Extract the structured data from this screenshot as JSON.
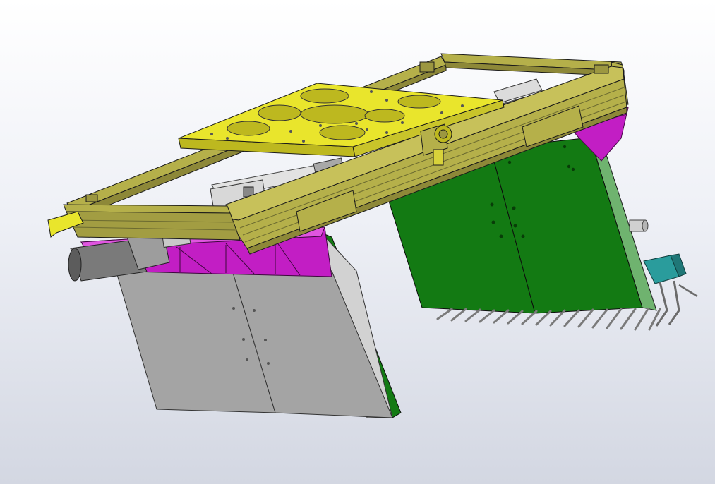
{
  "viewport": {
    "background_top": "#ffffff",
    "background_bottom": "#d3d7e2"
  },
  "model": {
    "parts": [
      {
        "name": "yellow-gripper-plate",
        "color": "#e9e52c"
      },
      {
        "name": "olive-aluminum-frame",
        "color": "#b5b04a"
      },
      {
        "name": "magenta-mounting-blocks",
        "color": "#c21ec4"
      },
      {
        "name": "grey-fork-plate",
        "color": "#a4a4a4"
      },
      {
        "name": "green-fork-plate",
        "color": "#137a13"
      },
      {
        "name": "servo-motor",
        "color": "#7f7f7f"
      },
      {
        "name": "teal-bracket",
        "color": "#2a9c9c"
      },
      {
        "name": "fork-tines",
        "color": "#8c8c8c"
      }
    ]
  }
}
